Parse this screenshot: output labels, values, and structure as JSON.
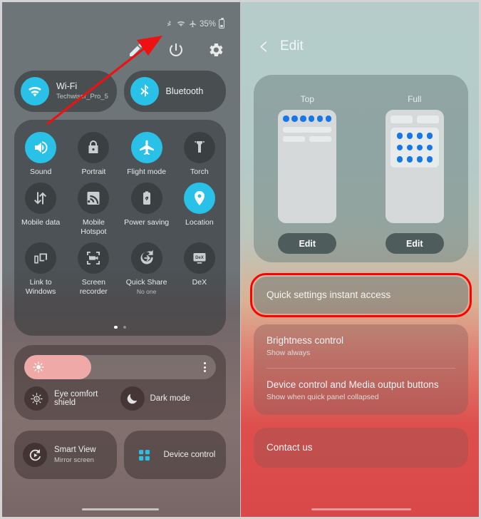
{
  "left_panel": {
    "status_bar": {
      "icons": [
        "bluetooth-icon",
        "wifi-icon",
        "airplane-icon"
      ],
      "battery_percent": "35%"
    },
    "top_actions": [
      {
        "name": "edit-pencil-button",
        "icon": "pencil-icon"
      },
      {
        "name": "power-button",
        "icon": "power-icon"
      },
      {
        "name": "settings-button",
        "icon": "gear-icon"
      }
    ],
    "pills": [
      {
        "title": "Wi-Fi",
        "subtitle": "Techwiser_Pro_5",
        "icon": "wifi-icon",
        "active": true
      },
      {
        "title": "Bluetooth",
        "subtitle": "",
        "icon": "bluetooth-icon",
        "active": true
      }
    ],
    "tiles": [
      {
        "label": "Sound",
        "sub": "",
        "icon": "speaker-icon",
        "on": true
      },
      {
        "label": "Portrait",
        "sub": "",
        "icon": "rotation-lock-icon",
        "on": false
      },
      {
        "label": "Flight mode",
        "sub": "",
        "icon": "airplane-icon",
        "on": true
      },
      {
        "label": "Torch",
        "sub": "",
        "icon": "flashlight-icon",
        "on": false
      },
      {
        "label": "Mobile data",
        "sub": "",
        "icon": "data-transfer-icon",
        "on": false
      },
      {
        "label": "Mobile Hotspot",
        "sub": "",
        "icon": "hotspot-icon",
        "on": false
      },
      {
        "label": "Power saving",
        "sub": "",
        "icon": "battery-leaf-icon",
        "on": false
      },
      {
        "label": "Location",
        "sub": "",
        "icon": "location-pin-icon",
        "on": true
      },
      {
        "label": "Link to Windows",
        "sub": "",
        "icon": "link-devices-icon",
        "on": false
      },
      {
        "label": "Screen recorder",
        "sub": "",
        "icon": "screen-record-icon",
        "on": false
      },
      {
        "label": "Quick Share",
        "sub": "No one",
        "icon": "quick-share-icon",
        "on": false
      },
      {
        "label": "DeX",
        "sub": "",
        "icon": "dex-monitor-icon",
        "on": false
      }
    ],
    "pager": {
      "pages": 2,
      "active": 1
    },
    "brightness": {
      "fill_percent": "35%",
      "slider_icon": "sun-icon",
      "menu_icon": "kebab-menu-icon",
      "items": [
        {
          "label": "Eye comfort shield",
          "icon": "eye-comfort-icon"
        },
        {
          "label": "Dark mode",
          "icon": "moon-icon"
        }
      ]
    },
    "bottom_cards": [
      {
        "title": "Smart View",
        "sub": "Mirror screen",
        "icon": "smart-view-icon"
      },
      {
        "title": "Device control",
        "sub": "",
        "icon": "device-control-grid-icon"
      }
    ]
  },
  "right_panel": {
    "header": {
      "back_icon": "chevron-left-icon",
      "title": "Edit"
    },
    "previews": [
      {
        "caption": "Top",
        "button": "Edit",
        "layout": "top"
      },
      {
        "caption": "Full",
        "button": "Edit",
        "layout": "full"
      }
    ],
    "options": [
      {
        "title": "Quick settings instant access",
        "sub": "",
        "highlighted": true
      },
      {
        "title": "Brightness control",
        "sub": "Show always",
        "highlighted": false
      },
      {
        "title": "Device control and Media output buttons",
        "sub": "Show when quick panel collapsed",
        "highlighted": false
      },
      {
        "title": "Contact us",
        "sub": "",
        "highlighted": false
      }
    ]
  },
  "annotations": {
    "arrow_color": "#ee1111",
    "highlight_color": "#ff0000"
  }
}
